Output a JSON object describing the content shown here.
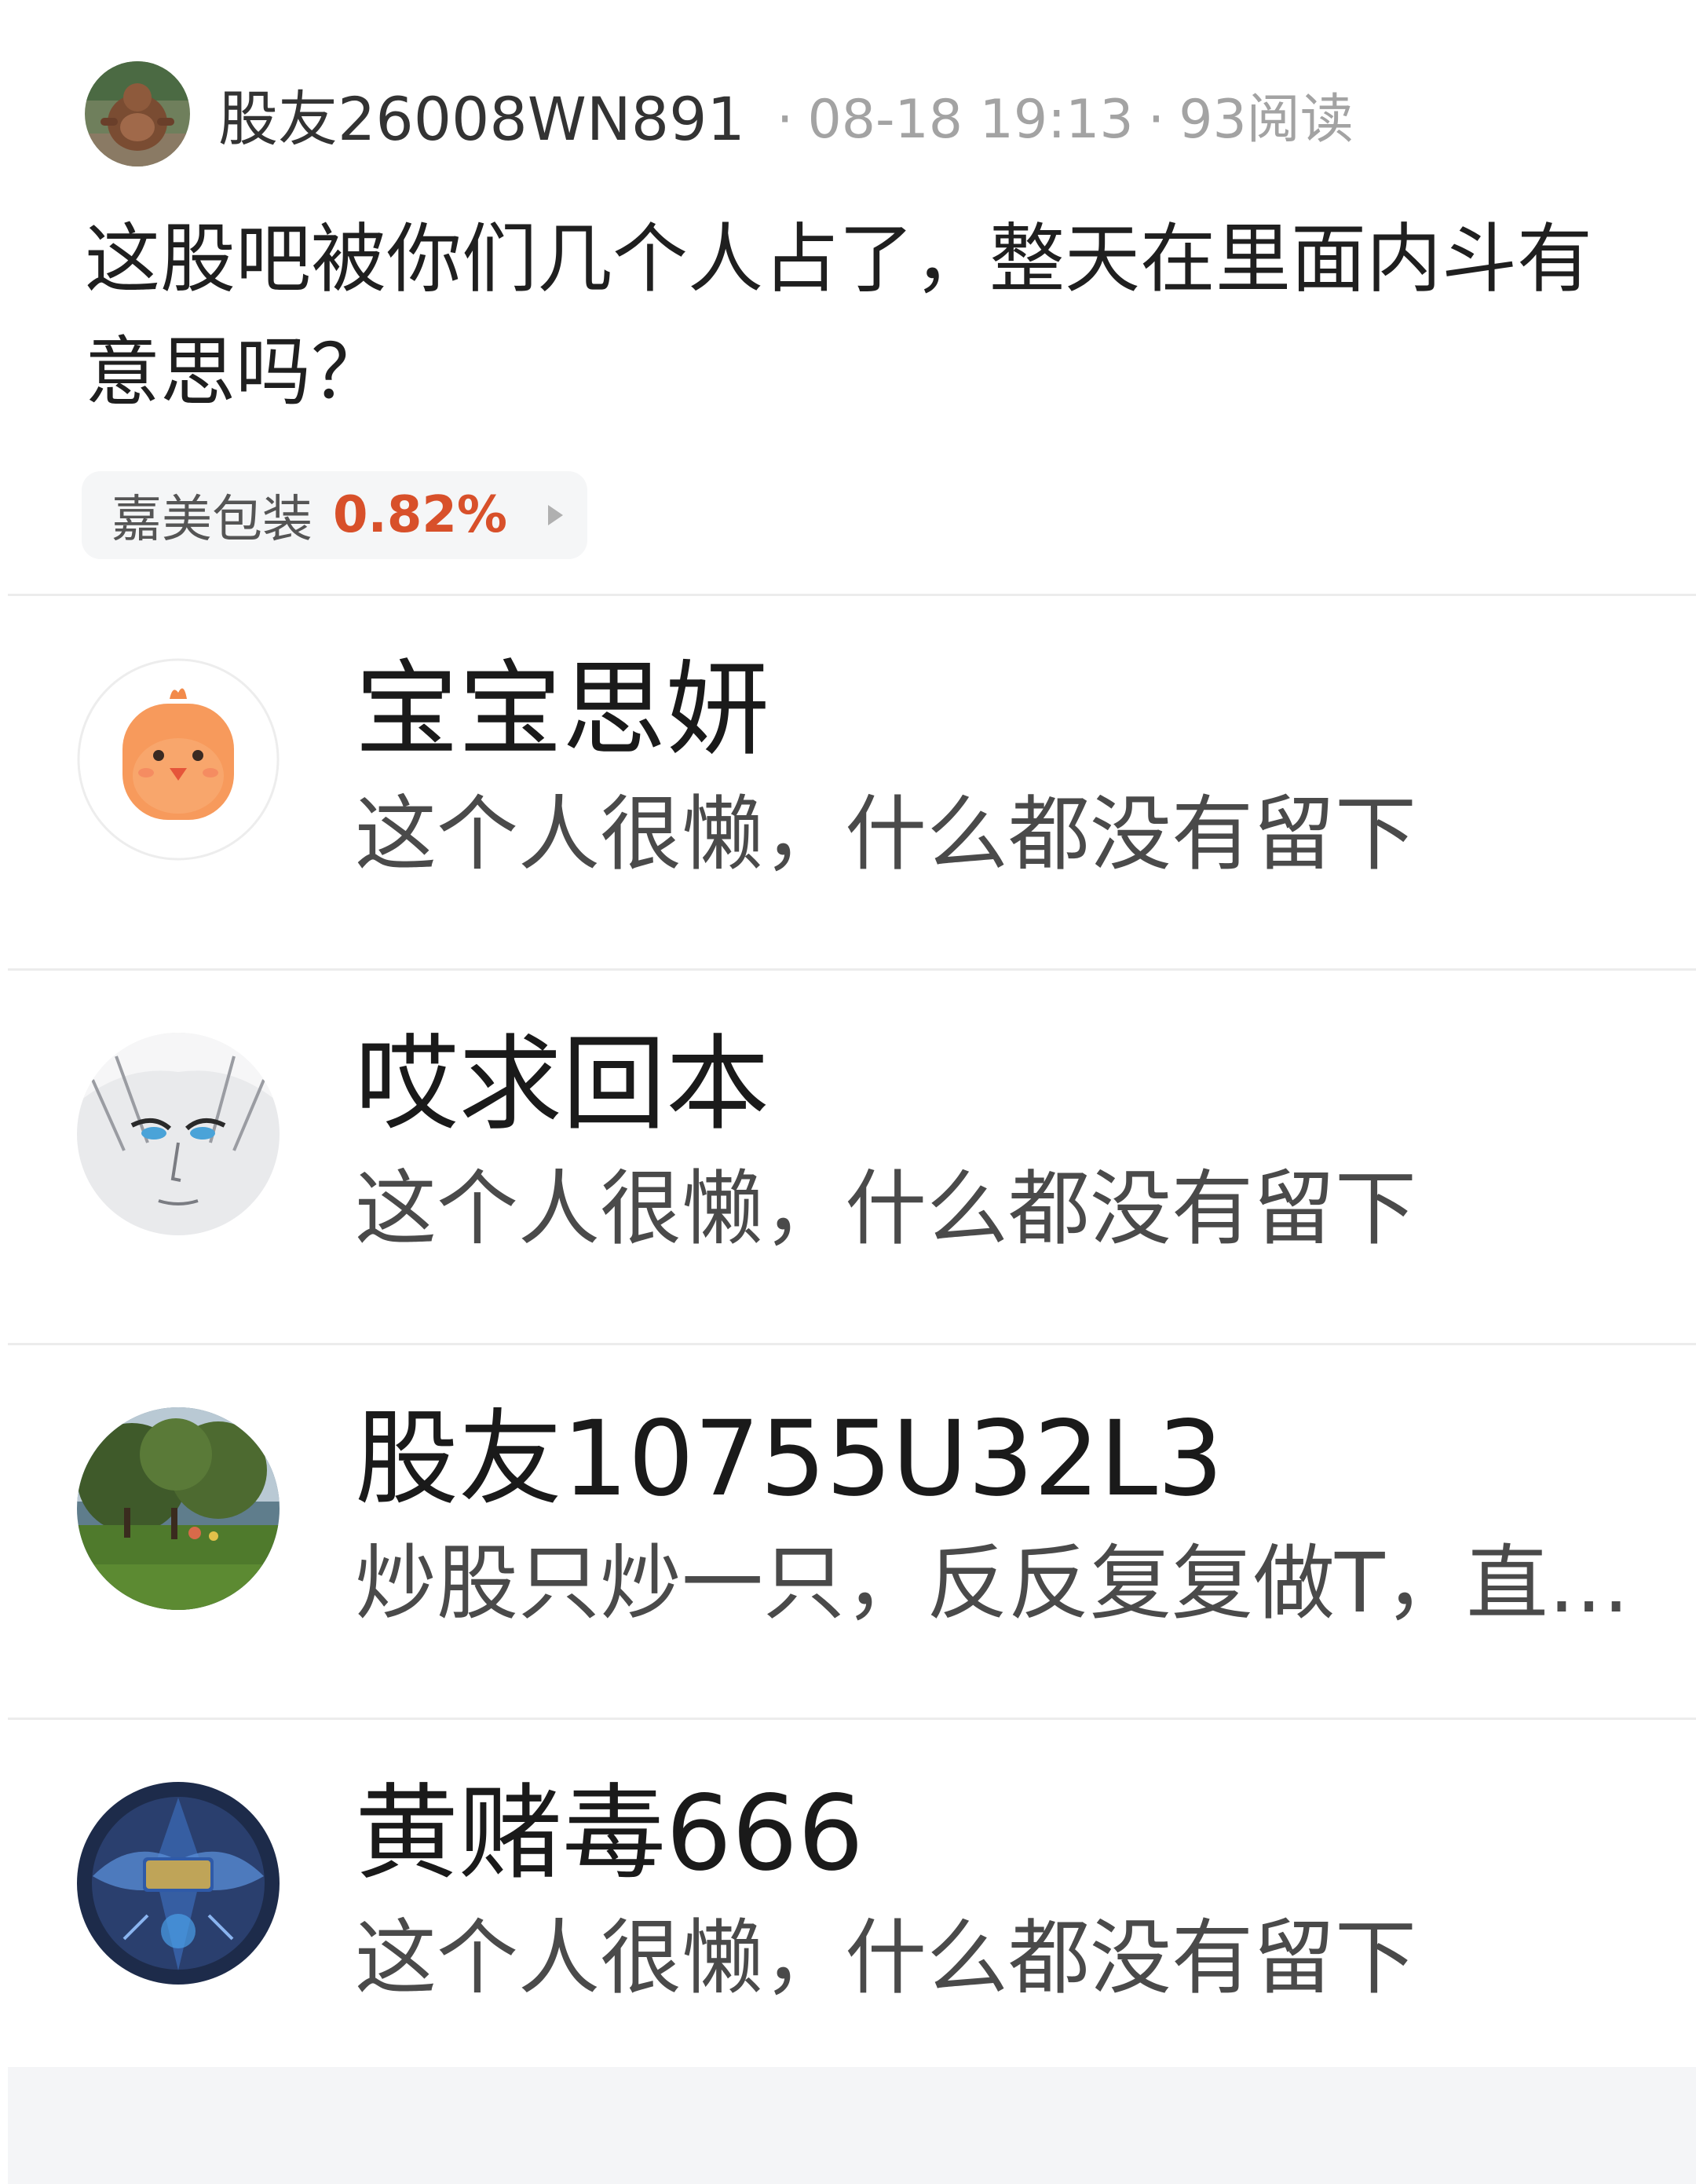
{
  "post": {
    "author_name": "股友26008WN891",
    "date": "08-18 19:13",
    "reads": "93阅读",
    "separator": "·",
    "content": "这股吧被你们几个人占了，整天在里面内斗有意思吗？",
    "stock": {
      "name": "嘉美包装",
      "change": "0.82%",
      "change_color": "#d8502a"
    }
  },
  "users": [
    {
      "name": "宝宝思妍",
      "bio": "这个人很懒，什么都没有留下",
      "avatar": "orange-chick-avatar"
    },
    {
      "name": "哎求回本",
      "bio": "这个人很懒，什么都没有留下",
      "avatar": "anime-face-avatar"
    },
    {
      "name": "股友10755U32L3",
      "bio": "炒股只炒一只，反反复复做T，直…",
      "avatar": "park-photo-avatar"
    },
    {
      "name": "黄赌毒666",
      "bio": "这个人很懒，什么都没有留下",
      "avatar": "game-victory-avatar"
    }
  ]
}
